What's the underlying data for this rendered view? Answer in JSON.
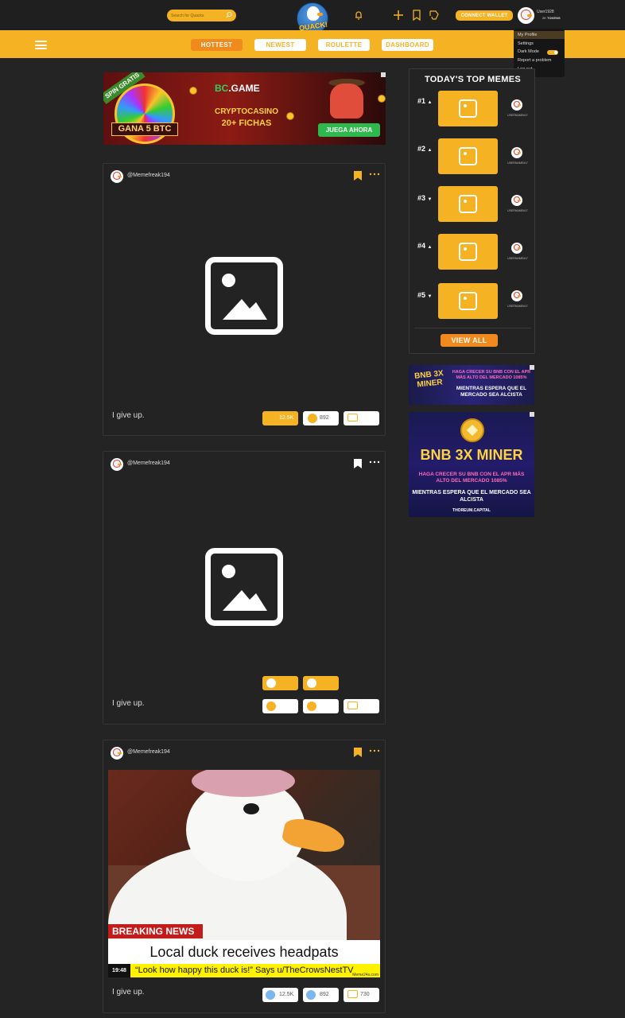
{
  "header": {
    "search_placeholder": "Search for Quacks",
    "logo_text": "QUACK!",
    "connect_wallet_label": "CONNECT WALLET",
    "user_name": "User1928",
    "user_tokens_value": "2K",
    "user_tokens_label": "TOKENS"
  },
  "user_menu": {
    "items": [
      "My Profile",
      "Settings",
      "Dark Mode",
      "Report a problem",
      "Log out"
    ],
    "dark_mode": true
  },
  "nav": {
    "tabs": [
      "HOTTEST",
      "NEWEST",
      "ROULETTE",
      "DASHBOARD"
    ],
    "active_tab": "HOTTEST"
  },
  "ad_bcgame": {
    "spin_label": "SPIN GRATIS",
    "prize_label": "GANA 5 BTC",
    "brand_prefix": "BC",
    "brand_suffix": ".GAME",
    "line1": "CRYPTOCASINO",
    "line2": "20+ FICHAS",
    "cta": "JUEGA AHORA"
  },
  "posts": [
    {
      "username": "@Memefreak194",
      "caption": "I give up.",
      "bookmarked": true,
      "likes": "12.5K",
      "coins": "892",
      "comments": ""
    },
    {
      "username": "@Memefreak194",
      "caption": "I give up.",
      "bookmarked": false,
      "likes": "",
      "coins": "",
      "comments": ""
    },
    {
      "username": "@Memefreak194",
      "caption": "I give up.",
      "bookmarked": true,
      "likes": "12.5K",
      "coins": "892",
      "comments": "730",
      "image": {
        "breaking_label": "BREAKING NEWS",
        "headline": "Local duck receives headpats",
        "time": "19:48",
        "ticker": "“Look how happy this duck is!” Says u/TheCrowsNestTV",
        "watermark": "Meme24s.com"
      }
    }
  ],
  "top_memes": {
    "title": "TODAY'S TOP MEMES",
    "items": [
      {
        "rank": "#1",
        "trend": "up",
        "user": "USERNAME#17"
      },
      {
        "rank": "#2",
        "trend": "up",
        "user": "USERNAME#17"
      },
      {
        "rank": "#3",
        "trend": "down",
        "user": "USERNAME#17"
      },
      {
        "rank": "#4",
        "trend": "up",
        "user": "USERNAME#17"
      },
      {
        "rank": "#5",
        "trend": "down",
        "user": "USERNAME#17"
      }
    ],
    "view_all_label": "VIEW ALL"
  },
  "ad_bnb_small": {
    "title": "BNB 3X MINER",
    "line1": "HAGA CRECER SU BNB CON EL APR MÁS ALTO DEL MERCADO 1085%",
    "line2": "MIENTRAS ESPERA QUE EL MERCADO SEA ALCISTA"
  },
  "ad_bnb_large": {
    "title": "BNB 3X MINER",
    "line1": "HAGA CRECER SU BNB CON EL APR MÁS ALTO DEL MERCADO 1085%",
    "line2": "MIENTRAS ESPERA QUE EL MERCADO SEA ALCISTA",
    "domain": "THOREUM.CAPITAL"
  },
  "colors": {
    "accent": "#f5b324",
    "accent_active": "#f08a1c",
    "background": "#242424"
  }
}
